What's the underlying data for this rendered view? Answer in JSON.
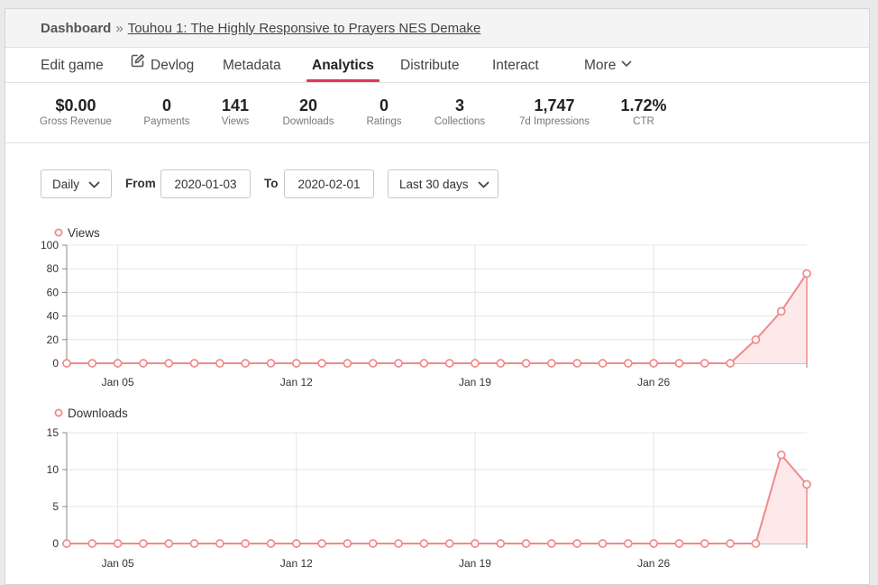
{
  "breadcrumb": {
    "root": "Dashboard",
    "separator": "»",
    "game": "Touhou 1: The Highly Responsive to Prayers NES Demake"
  },
  "tabs": [
    {
      "label": "Edit game",
      "icon": ""
    },
    {
      "label": "Devlog",
      "icon": "edit-icon"
    },
    {
      "label": "Metadata",
      "icon": ""
    },
    {
      "label": "Analytics",
      "icon": "",
      "active": true
    },
    {
      "label": "Distribute",
      "icon": ""
    },
    {
      "label": "Interact",
      "icon": ""
    },
    {
      "label": "More",
      "icon": "chevron-down-icon"
    }
  ],
  "stats": [
    {
      "value": "$0.00",
      "label": "Gross Revenue"
    },
    {
      "value": "0",
      "label": "Payments"
    },
    {
      "value": "141",
      "label": "Views"
    },
    {
      "value": "20",
      "label": "Downloads"
    },
    {
      "value": "0",
      "label": "Ratings"
    },
    {
      "value": "3",
      "label": "Collections"
    },
    {
      "value": "1,747",
      "label": "7d Impressions"
    },
    {
      "value": "1.72%",
      "label": "CTR"
    }
  ],
  "filters": {
    "interval": "Daily",
    "from_label": "From",
    "from_value": "2020-01-03",
    "to_label": "To",
    "to_value": "2020-02-01",
    "range": "Last 30 days"
  },
  "colors": {
    "accent": "#e0365a",
    "series": "#f08a8a",
    "fill": "#fde9ea"
  },
  "chart_data": [
    {
      "type": "area",
      "series_name": "Views",
      "x": [
        "2020-01-03",
        "2020-01-04",
        "2020-01-05",
        "2020-01-06",
        "2020-01-07",
        "2020-01-08",
        "2020-01-09",
        "2020-01-10",
        "2020-01-11",
        "2020-01-12",
        "2020-01-13",
        "2020-01-14",
        "2020-01-15",
        "2020-01-16",
        "2020-01-17",
        "2020-01-18",
        "2020-01-19",
        "2020-01-20",
        "2020-01-21",
        "2020-01-22",
        "2020-01-23",
        "2020-01-24",
        "2020-01-25",
        "2020-01-26",
        "2020-01-27",
        "2020-01-28",
        "2020-01-29",
        "2020-01-30",
        "2020-01-31",
        "2020-02-01"
      ],
      "values": [
        0,
        0,
        0,
        0,
        0,
        0,
        0,
        0,
        0,
        0,
        0,
        0,
        0,
        0,
        0,
        0,
        0,
        0,
        0,
        0,
        0,
        0,
        0,
        0,
        0,
        0,
        0,
        20,
        44,
        76
      ],
      "ylim": [
        0,
        100
      ],
      "yticks": [
        "0",
        "20",
        "40",
        "60",
        "80",
        "100"
      ],
      "xtick_labels": [
        "Jan 05",
        "Jan 12",
        "Jan 19",
        "Jan 26"
      ],
      "grid": true
    },
    {
      "type": "area",
      "series_name": "Downloads",
      "x": [
        "2020-01-03",
        "2020-01-04",
        "2020-01-05",
        "2020-01-06",
        "2020-01-07",
        "2020-01-08",
        "2020-01-09",
        "2020-01-10",
        "2020-01-11",
        "2020-01-12",
        "2020-01-13",
        "2020-01-14",
        "2020-01-15",
        "2020-01-16",
        "2020-01-17",
        "2020-01-18",
        "2020-01-19",
        "2020-01-20",
        "2020-01-21",
        "2020-01-22",
        "2020-01-23",
        "2020-01-24",
        "2020-01-25",
        "2020-01-26",
        "2020-01-27",
        "2020-01-28",
        "2020-01-29",
        "2020-01-30",
        "2020-01-31",
        "2020-02-01"
      ],
      "values": [
        0,
        0,
        0,
        0,
        0,
        0,
        0,
        0,
        0,
        0,
        0,
        0,
        0,
        0,
        0,
        0,
        0,
        0,
        0,
        0,
        0,
        0,
        0,
        0,
        0,
        0,
        0,
        0,
        12,
        8
      ],
      "ylim": [
        0,
        15
      ],
      "yticks": [
        "0",
        "5",
        "10",
        "15"
      ],
      "xtick_labels": [
        "Jan 05",
        "Jan 12",
        "Jan 19",
        "Jan 26"
      ],
      "grid": true
    }
  ]
}
